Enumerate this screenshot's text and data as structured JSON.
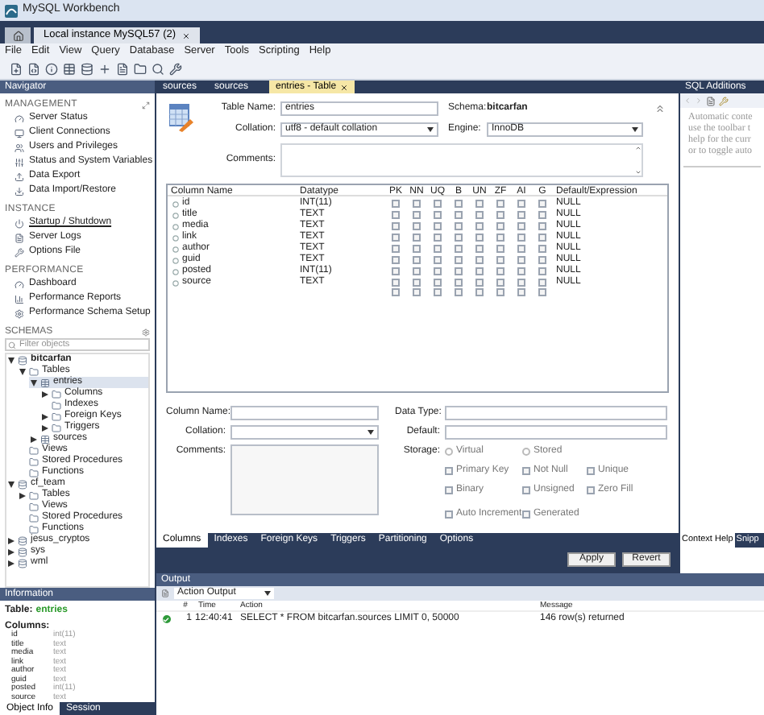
{
  "window": {
    "title": "MySQL Workbench"
  },
  "connection_tabs": [
    {
      "label": "Local instance MySQL57 (2)",
      "selected": true
    }
  ],
  "menu": [
    "File",
    "Edit",
    "View",
    "Query",
    "Database",
    "Server",
    "Tools",
    "Scripting",
    "Help"
  ],
  "navigator": {
    "title": "Navigator",
    "sections": [
      {
        "title": "MANAGEMENT",
        "items": [
          {
            "label": "Server Status",
            "selected": false
          },
          {
            "label": "Client Connections",
            "selected": false
          },
          {
            "label": "Users and Privileges",
            "selected": false
          },
          {
            "label": "Status and System Variables",
            "selected": false
          },
          {
            "label": "Data Export",
            "selected": false
          },
          {
            "label": "Data Import/Restore",
            "selected": false
          }
        ]
      },
      {
        "title": "INSTANCE",
        "items": [
          {
            "label": "Startup / Shutdown",
            "selected": true
          },
          {
            "label": "Server Logs",
            "selected": false
          },
          {
            "label": "Options File",
            "selected": false
          }
        ]
      },
      {
        "title": "PERFORMANCE",
        "items": [
          {
            "label": "Dashboard",
            "selected": false
          },
          {
            "label": "Performance Reports",
            "selected": false
          },
          {
            "label": "Performance Schema Setup",
            "selected": false
          }
        ]
      }
    ],
    "schemas": {
      "title": "SCHEMAS",
      "filter_placeholder": "Filter objects",
      "tree": [
        {
          "label": "bitcarfan",
          "kind": "schema",
          "default": true,
          "selected": false,
          "expanded": true,
          "children": [
            {
              "label": "Tables",
              "kind": "folder",
              "selected": false,
              "expanded": true,
              "children": [
                {
                  "label": "entries",
                  "kind": "table",
                  "selected": true,
                  "expanded": true,
                  "children": [
                    {
                      "label": "Columns",
                      "kind": "folder",
                      "selected": false,
                      "expanded": false
                    },
                    {
                      "label": "Indexes",
                      "kind": "folder",
                      "selected": false
                    },
                    {
                      "label": "Foreign Keys",
                      "kind": "folder",
                      "selected": false,
                      "expanded": false
                    },
                    {
                      "label": "Triggers",
                      "kind": "folder",
                      "selected": false,
                      "expanded": false
                    }
                  ]
                },
                {
                  "label": "sources",
                  "kind": "table",
                  "selected": false,
                  "expanded": false
                }
              ]
            },
            {
              "label": "Views",
              "kind": "folder",
              "selected": false
            },
            {
              "label": "Stored Procedures",
              "kind": "folder",
              "selected": false
            },
            {
              "label": "Functions",
              "kind": "folder",
              "selected": false
            }
          ]
        },
        {
          "label": "cf_team",
          "kind": "schema",
          "default": false,
          "selected": false,
          "expanded": true,
          "children": [
            {
              "label": "Tables",
              "kind": "folder",
              "selected": false,
              "expanded": false
            },
            {
              "label": "Views",
              "kind": "folder",
              "selected": false
            },
            {
              "label": "Stored Procedures",
              "kind": "folder",
              "selected": false
            },
            {
              "label": "Functions",
              "kind": "folder",
              "selected": false
            }
          ]
        },
        {
          "label": "jesus_cryptos",
          "kind": "schema",
          "default": false,
          "selected": false,
          "expanded": false
        },
        {
          "label": "sys",
          "kind": "schema",
          "default": false,
          "selected": false,
          "expanded": false
        },
        {
          "label": "wml",
          "kind": "schema",
          "default": false,
          "selected": false,
          "expanded": false
        }
      ]
    }
  },
  "information": {
    "title": "Information",
    "table_label": "Table:",
    "table_name": "entries",
    "columns_label": "Columns:",
    "columns": [
      {
        "name": "id",
        "type": "int(11)"
      },
      {
        "name": "title",
        "type": "text"
      },
      {
        "name": "media",
        "type": "text"
      },
      {
        "name": "link",
        "type": "text"
      },
      {
        "name": "author",
        "type": "text"
      },
      {
        "name": "guid",
        "type": "text"
      },
      {
        "name": "posted",
        "type": "int(11)"
      },
      {
        "name": "source",
        "type": "text"
      }
    ],
    "tabs": [
      {
        "label": "Object Info",
        "selected": true
      },
      {
        "label": "Session",
        "selected": false
      }
    ]
  },
  "editor_tabs": [
    {
      "label": "sources",
      "selected": false
    },
    {
      "label": "sources",
      "selected": false
    },
    {
      "label": "entries - Table",
      "selected": true
    }
  ],
  "table_form": {
    "table_name_label": "Table Name:",
    "table_name": "entries",
    "schema_label": "Schema:",
    "schema": "bitcarfan",
    "collation_label": "Collation:",
    "collation": "utf8 - default collation",
    "engine_label": "Engine:",
    "engine": "InnoDB",
    "comments_label": "Comments:"
  },
  "columns_grid": {
    "headers": [
      "Column Name",
      "Datatype",
      "PK",
      "NN",
      "UQ",
      "B",
      "UN",
      "ZF",
      "AI",
      "G",
      "Default/Expression"
    ],
    "rows": [
      {
        "name": "id",
        "datatype": "INT(11)",
        "flags": [
          false,
          false,
          false,
          false,
          false,
          false,
          false,
          false
        ],
        "default": "NULL"
      },
      {
        "name": "title",
        "datatype": "TEXT",
        "flags": [
          false,
          false,
          false,
          false,
          false,
          false,
          false,
          false
        ],
        "default": "NULL"
      },
      {
        "name": "media",
        "datatype": "TEXT",
        "flags": [
          false,
          false,
          false,
          false,
          false,
          false,
          false,
          false
        ],
        "default": "NULL"
      },
      {
        "name": "link",
        "datatype": "TEXT",
        "flags": [
          false,
          false,
          false,
          false,
          false,
          false,
          false,
          false
        ],
        "default": "NULL"
      },
      {
        "name": "author",
        "datatype": "TEXT",
        "flags": [
          false,
          false,
          false,
          false,
          false,
          false,
          false,
          false
        ],
        "default": "NULL"
      },
      {
        "name": "guid",
        "datatype": "TEXT",
        "flags": [
          false,
          false,
          false,
          false,
          false,
          false,
          false,
          false
        ],
        "default": "NULL"
      },
      {
        "name": "posted",
        "datatype": "INT(11)",
        "flags": [
          false,
          false,
          false,
          false,
          false,
          false,
          false,
          false
        ],
        "default": "NULL"
      },
      {
        "name": "source",
        "datatype": "TEXT",
        "flags": [
          false,
          false,
          false,
          false,
          false,
          false,
          false,
          false
        ],
        "default": "NULL"
      },
      {
        "flags": [
          false,
          false,
          false,
          false,
          false,
          false,
          false,
          false
        ]
      }
    ]
  },
  "column_details": {
    "column_name_label": "Column Name:",
    "collation_label": "Collation:",
    "comments_label": "Comments:",
    "data_type_label": "Data Type:",
    "default_label": "Default:",
    "storage_label": "Storage:",
    "storage_options": [
      {
        "label": "Virtual",
        "selected": false
      },
      {
        "label": "Stored",
        "selected": false
      }
    ],
    "options": [
      {
        "label": "Primary Key",
        "checked": false
      },
      {
        "label": "Not Null",
        "checked": false
      },
      {
        "label": "Unique",
        "checked": false
      },
      {
        "label": "Binary",
        "checked": false
      },
      {
        "label": "Unsigned",
        "checked": false
      },
      {
        "label": "Zero Fill",
        "checked": false
      },
      {
        "label": "Auto Increment",
        "checked": false
      },
      {
        "label": "Generated",
        "checked": false
      }
    ]
  },
  "bottom_tabs": [
    {
      "label": "Columns",
      "selected": true
    },
    {
      "label": "Indexes",
      "selected": false
    },
    {
      "label": "Foreign Keys",
      "selected": false
    },
    {
      "label": "Triggers",
      "selected": false
    },
    {
      "label": "Partitioning",
      "selected": false
    },
    {
      "label": "Options",
      "selected": false
    }
  ],
  "buttons": [
    "Apply",
    "Revert"
  ],
  "sql_additions": {
    "title": "SQL Additions",
    "help_lines": [
      "Automatic conte",
      "use the toolbar t",
      "help for the curr",
      "or to toggle auto"
    ],
    "tabs": [
      {
        "label": "Context Help",
        "selected": true
      },
      {
        "label": "Snipp",
        "selected": false
      }
    ]
  },
  "output": {
    "title": "Output",
    "selector": "Action Output",
    "columns": [
      "#",
      "Time",
      "Action",
      "Message"
    ],
    "rows": [
      {
        "number": "1",
        "time": "12:40:41",
        "action": "SELECT * FROM bitcarfan.sources LIMIT 0, 50000",
        "message": "146 row(s) returned"
      }
    ]
  }
}
